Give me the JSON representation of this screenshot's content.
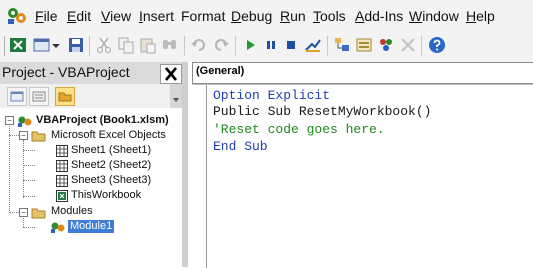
{
  "menu": {
    "items": [
      {
        "ul": "F",
        "rest": "ile"
      },
      {
        "ul": "E",
        "rest": "dit"
      },
      {
        "ul": "V",
        "rest": "iew"
      },
      {
        "ul": "I",
        "rest": "nsert"
      },
      {
        "ul": "",
        "rest": "Format"
      },
      {
        "ul": "D",
        "rest": "ebug"
      },
      {
        "ul": "R",
        "rest": "un"
      },
      {
        "ul": "T",
        "rest": "ools"
      },
      {
        "ul": "A",
        "rest": "dd-Ins"
      },
      {
        "ul": "W",
        "rest": "indow"
      },
      {
        "ul": "H",
        "rest": "elp"
      }
    ]
  },
  "project_pane": {
    "title": "Project - VBAProject",
    "close_label": "✕"
  },
  "tree": {
    "project": "VBAProject (Book1.xlsm)",
    "folder_objects": "Microsoft Excel Objects",
    "sheet1": "Sheet1 (Sheet1)",
    "sheet2": "Sheet2 (Sheet2)",
    "sheet3": "Sheet3 (Sheet3)",
    "thisworkbook": "ThisWorkbook",
    "folder_modules": "Modules",
    "module1": "Module1"
  },
  "code_window": {
    "object_dropdown": "(General)",
    "lines": [
      {
        "text": "Option Explicit",
        "color": "#1f3fb0"
      },
      {
        "text": "Public Sub ResetMyWorkbook()",
        "color": "#1a1a1a"
      },
      {
        "text": "'Reset code goes here.",
        "color": "#1e8a1e"
      },
      {
        "text": "End Sub",
        "color": "#1f3fb0"
      }
    ]
  },
  "colors": {
    "selection": "#3d7dd6",
    "keyword": "#1f3fb0",
    "comment": "#1e8a1e"
  }
}
